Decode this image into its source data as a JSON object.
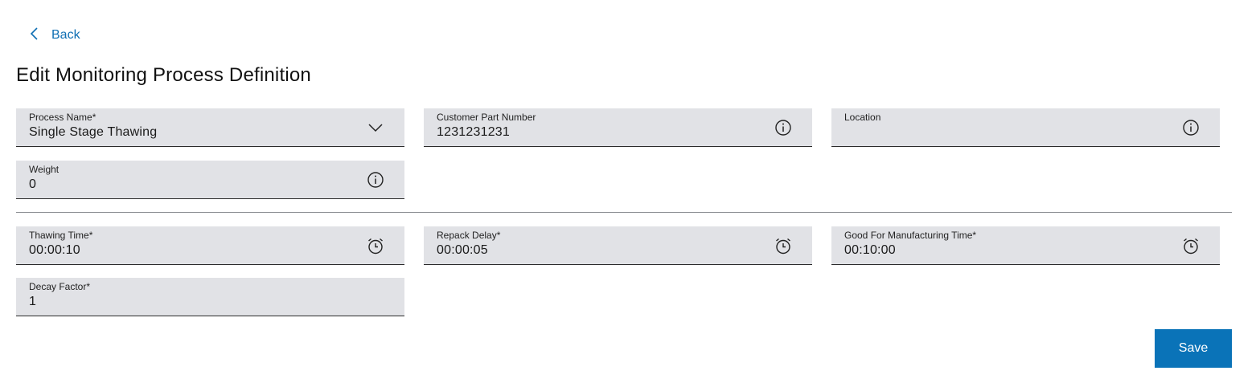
{
  "nav": {
    "back_label": "Back"
  },
  "header": {
    "title": "Edit Monitoring Process Definition"
  },
  "form": {
    "process_name": {
      "label": "Process Name*",
      "value": "Single Stage Thawing",
      "icon": "chevron-down-icon"
    },
    "customer_part_number": {
      "label": "Customer Part Number",
      "value": "1231231231",
      "icon": "info-icon"
    },
    "location": {
      "label": "Location",
      "value": "",
      "icon": "info-icon"
    },
    "weight": {
      "label": "Weight",
      "value": "0",
      "icon": "info-icon"
    },
    "thawing_time": {
      "label": "Thawing Time*",
      "value": "00:00:10",
      "icon": "alarm-clock-icon"
    },
    "repack_delay": {
      "label": "Repack Delay*",
      "value": "00:00:05",
      "icon": "alarm-clock-icon"
    },
    "good_for_manufacturing_time": {
      "label": "Good For Manufacturing Time*",
      "value": "00:10:00",
      "icon": "alarm-clock-icon"
    },
    "decay_factor": {
      "label": "Decay Factor*",
      "value": "1"
    }
  },
  "actions": {
    "save_label": "Save"
  },
  "colors": {
    "accent": "#0a73b8",
    "link": "#0f6fb3",
    "field_bg": "#e1e2e6"
  }
}
